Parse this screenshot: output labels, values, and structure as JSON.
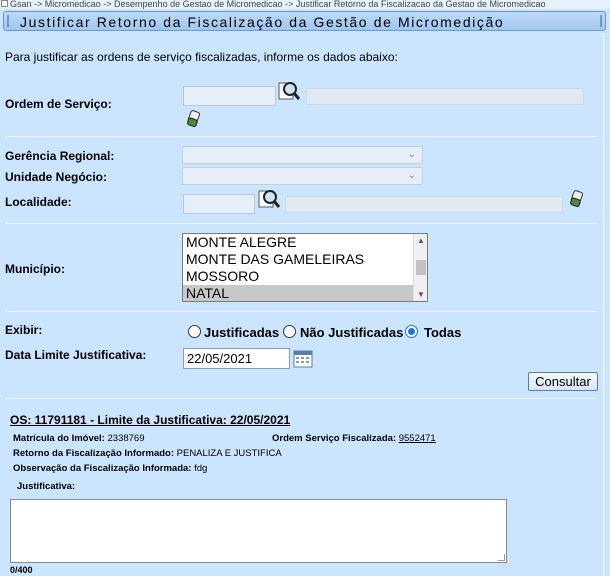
{
  "breadcrumb": "Gsan -> Micromedicao -> Desempenho de Gestao de Micromedicao -> Justificar Retorno da Fiscalizacao da Gestao de Micromedicao",
  "page_title": "Justificar Retorno da Fiscalização da Gestão de Micromedição",
  "intro": "Para justificar as ordens de serviço fiscalizadas, informe os dados abaixo:",
  "form": {
    "ordem_servico_label": "Ordem de Serviço:",
    "ordem_servico_value": "",
    "ordem_servico_desc": "",
    "gerencia_label": "Gerência Regional:",
    "gerencia_value": "",
    "unidade_label": "Unidade Negócio:",
    "unidade_value": "",
    "localidade_label": "Localidade:",
    "localidade_value": "",
    "localidade_desc": "",
    "municipio_label": "Município:",
    "municipio_options": [
      "MONTE ALEGRE",
      "MONTE DAS GAMELEIRAS",
      "MOSSORO",
      "NATAL"
    ],
    "municipio_selected": "NATAL",
    "exibir_label": "Exibir:",
    "exibir_options": [
      "Justificadas",
      "Não Justificadas",
      "Todas"
    ],
    "exibir_selected": "Todas",
    "data_limite_label": "Data Limite Justificativa:",
    "data_limite_value": "22/05/2021",
    "consultar_label": "Consultar"
  },
  "resultado": {
    "os_header": "OS: 11791181 - Limite da Justificativa: 22/05/2021",
    "matricula_label": "Matrícula do Imóvel:",
    "matricula_value": "2338769",
    "ordem_fiscalizada_label": "Ordem Serviço Fiscalizada:",
    "ordem_fiscalizada_value": "9552471",
    "retorno_label": "Retorno da Fiscalização Informado:",
    "retorno_value": "PENALIZA E JUSTIFICA",
    "observacao_label": "Observação da Fiscalização Informada:",
    "observacao_value": "fdg",
    "justificativa_label": "Justificativa:",
    "justificativa_value": "",
    "counter": "0/400"
  },
  "icons": {
    "lupa": "magnifier-icon",
    "borracha": "eraser-icon",
    "calendario": "calendar-icon"
  }
}
